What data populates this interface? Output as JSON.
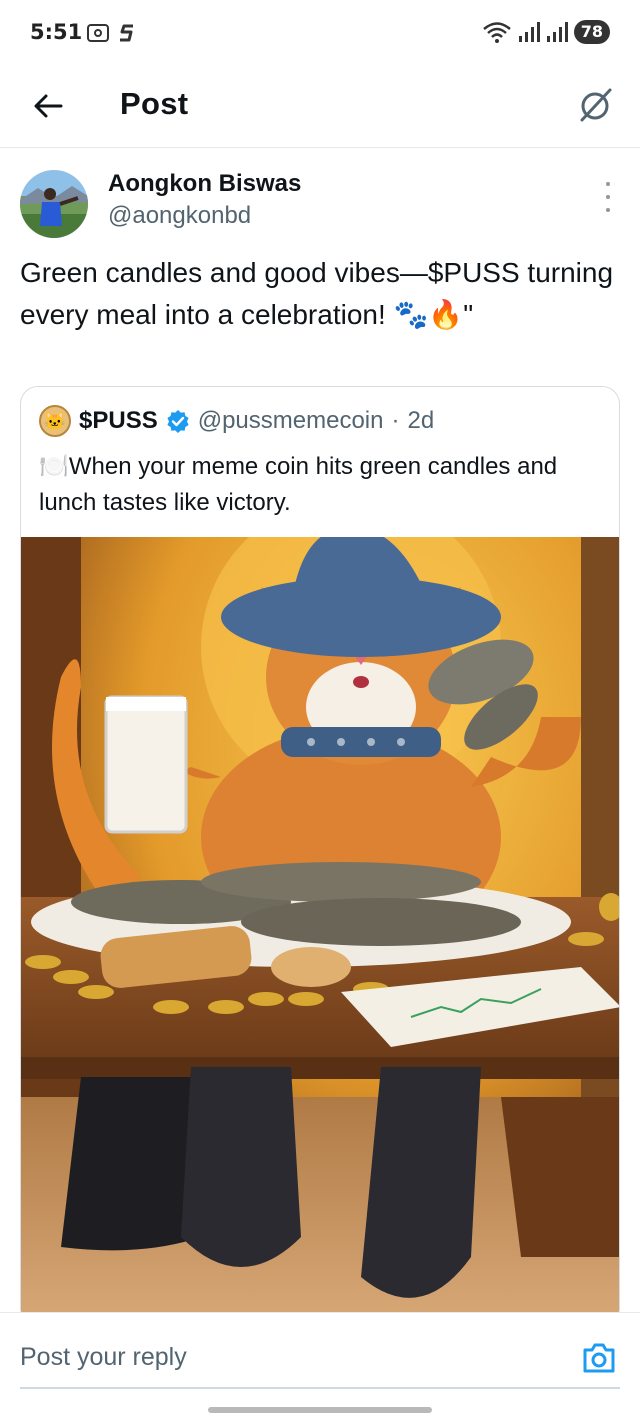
{
  "status_bar": {
    "time": "5:51",
    "battery": "78",
    "icons": [
      "screenshot-icon",
      "s-app-icon",
      "wifi-icon",
      "signal-icon",
      "signal-icon",
      "battery-icon"
    ]
  },
  "header": {
    "title": "Post",
    "back_icon": "back-arrow-icon",
    "grok_icon": "grok-icon"
  },
  "post": {
    "author_name": "Aongkon Biswas",
    "author_handle": "@aongkonbd",
    "text": "Green candles and good vibes—$PUSS turning every meal into a celebration! 🐾🔥\"",
    "quote": {
      "name": "$PUSS",
      "handle": "@pussmemecoin",
      "dot": "·",
      "time": "2d",
      "text": "🍽️When your meme coin hits green candles and lunch tastes like victory."
    }
  },
  "reply": {
    "placeholder": "Post your reply"
  },
  "colors": {
    "accent": "#1d9bf0",
    "text": "#0f1419",
    "muted": "#536471",
    "border": "#e6e9eb"
  }
}
